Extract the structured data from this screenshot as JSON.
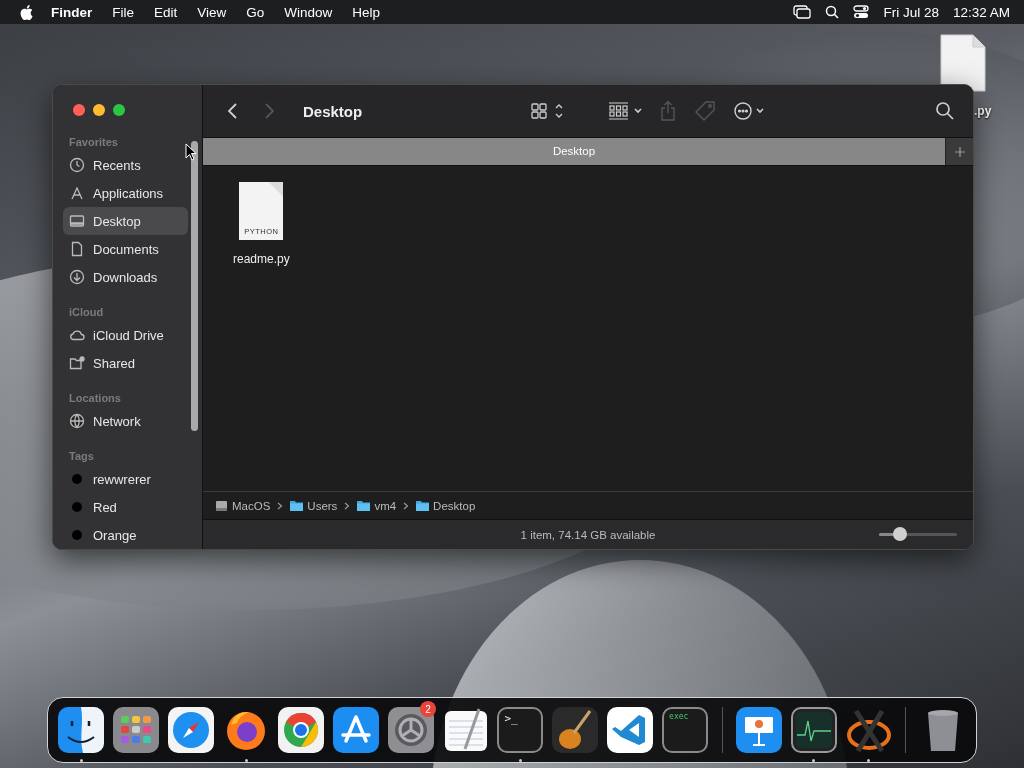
{
  "menu_bar": {
    "app": "Finder",
    "menus": [
      "File",
      "Edit",
      "View",
      "Go",
      "Window",
      "Help"
    ],
    "date": "Fri Jul 28",
    "time": "12:32 AM"
  },
  "desktop_file": {
    "label": ".py"
  },
  "window": {
    "title": "Desktop",
    "tab": "Desktop",
    "toolbar": [
      {
        "kind": "back",
        "disabled": false
      },
      {
        "kind": "forward",
        "disabled": true
      },
      {
        "kind": "title"
      },
      {
        "kind": "view",
        "disabled": false
      },
      {
        "kind": "group",
        "disabled": false
      },
      {
        "kind": "share",
        "disabled": true
      },
      {
        "kind": "tag",
        "disabled": true
      },
      {
        "kind": "more",
        "disabled": false
      },
      {
        "kind": "search",
        "disabled": false
      }
    ],
    "sidebar": [
      {
        "heading": "Favorites",
        "items": [
          {
            "label": "Recents",
            "kind": "clock",
            "selected": false
          },
          {
            "label": "Applications",
            "kind": "apps",
            "selected": false
          },
          {
            "label": "Desktop",
            "kind": "desktop",
            "selected": true
          },
          {
            "label": "Documents",
            "kind": "document",
            "selected": false
          },
          {
            "label": "Downloads",
            "kind": "download",
            "selected": false
          }
        ]
      },
      {
        "heading": "iCloud",
        "items": [
          {
            "label": "iCloud Drive",
            "kind": "cloud",
            "selected": false
          },
          {
            "label": "Shared",
            "kind": "shared",
            "selected": false
          }
        ]
      },
      {
        "heading": "Locations",
        "items": [
          {
            "label": "Network",
            "kind": "network",
            "selected": false
          }
        ]
      },
      {
        "heading": "Tags",
        "items": [
          {
            "label": "rewwrerer",
            "kind": "tag",
            "color": "#000000",
            "selected": false
          },
          {
            "label": "Red",
            "kind": "tag",
            "color": "#000000",
            "selected": false
          },
          {
            "label": "Orange",
            "kind": "tag",
            "color": "#000000",
            "selected": false
          }
        ]
      }
    ],
    "files": [
      {
        "name": "readme.py",
        "badge": "PYTHON"
      }
    ],
    "path": [
      {
        "label": "MacOS",
        "kind": "disk"
      },
      {
        "label": "Users",
        "kind": "folder"
      },
      {
        "label": "vm4",
        "kind": "folder"
      },
      {
        "label": "Desktop",
        "kind": "folder"
      }
    ],
    "status": "1 item, 74.14 GB available",
    "icon_size": {
      "level": 0.27
    }
  },
  "dock": [
    {
      "kind": "finder",
      "running": true
    },
    {
      "kind": "launchpad",
      "running": false
    },
    {
      "kind": "safari",
      "running": false
    },
    {
      "kind": "firefox",
      "running": true
    },
    {
      "kind": "chrome",
      "running": false
    },
    {
      "kind": "appstore",
      "running": false
    },
    {
      "kind": "settings",
      "running": false,
      "badge": "2"
    },
    {
      "kind": "textedit",
      "running": false
    },
    {
      "kind": "terminal",
      "running": true,
      "text": ">_"
    },
    {
      "kind": "guitar",
      "running": false
    },
    {
      "kind": "vscode",
      "running": false
    },
    {
      "kind": "exec",
      "running": false,
      "text": "exec"
    },
    {
      "kind": "separator"
    },
    {
      "kind": "keynote",
      "running": false
    },
    {
      "kind": "monitor",
      "running": true
    },
    {
      "kind": "xquartz",
      "running": true
    },
    {
      "kind": "separator"
    },
    {
      "kind": "trash",
      "running": false
    }
  ]
}
